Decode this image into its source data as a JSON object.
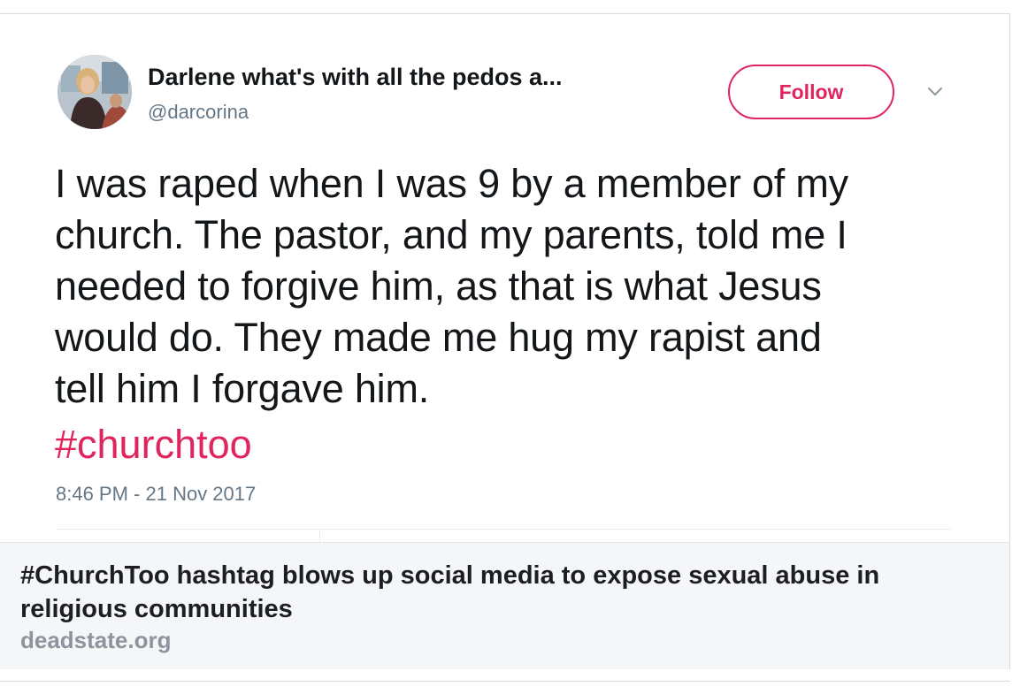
{
  "tweet": {
    "display_name": "Darlene what's with all the pedos a...",
    "handle": "@darcorina",
    "follow_label": "Follow",
    "text_lines": [
      "I was raped when I was 9 by a member of my",
      "church. The pastor, and my parents, told me I",
      "needed to forgive him, as that is what Jesus",
      "would do. They made me hug my rapist and",
      "tell him I forgave him."
    ],
    "hashtag": "#churchtoo",
    "timestamp": "8:46 PM - 21 Nov 2017"
  },
  "link_preview": {
    "title": "#ChurchToo hashtag blows up social media to expose sexual abuse in religious communities",
    "domain": "deadstate.org"
  },
  "colors": {
    "accent": "#e0245e",
    "text": "#14171a",
    "secondary": "#657786",
    "preview_bg": "#f5f6f7",
    "preview_domain": "#8d949e"
  },
  "icons": {
    "caret": "chevron-down-icon",
    "avatar": "user-avatar-photo"
  }
}
